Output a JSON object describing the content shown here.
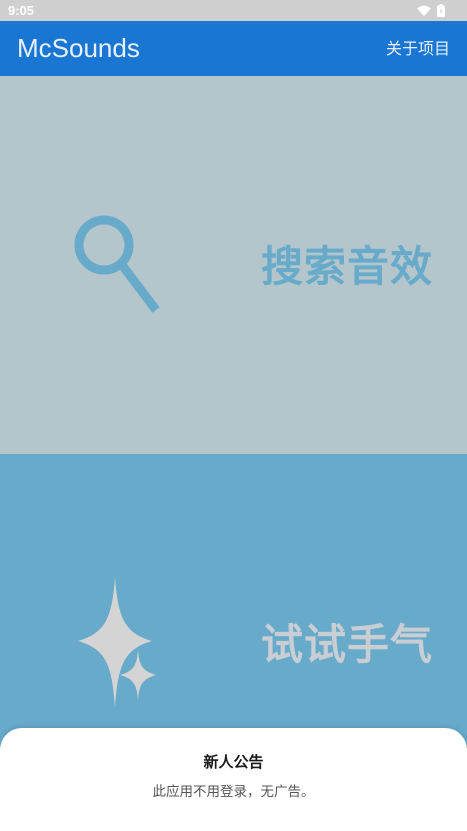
{
  "status_bar": {
    "time": "9:05",
    "icons": [
      "wifi-icon",
      "battery-icon"
    ]
  },
  "app_bar": {
    "title": "McSounds",
    "action_label": "关于项目",
    "color": "#1976d2"
  },
  "tiles": [
    {
      "label": "搜索音效",
      "icon": "search-icon",
      "background": "#b4c5cc",
      "accent": "#67aaca"
    },
    {
      "label": "试试手气",
      "icon": "sparkle-icon",
      "background": "#67aaca",
      "accent": "#c9ced4"
    }
  ],
  "notice": {
    "title": "新人公告",
    "message": "此应用不用登录，无广告。"
  }
}
